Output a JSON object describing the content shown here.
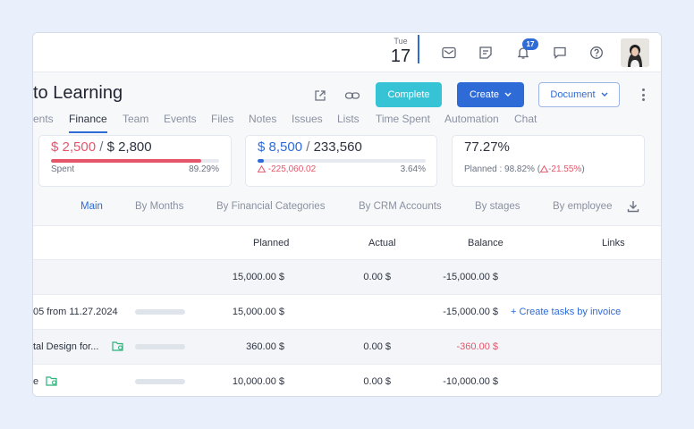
{
  "topbar": {
    "date_dow": "Tue",
    "date_day": "17",
    "notification_count": "17"
  },
  "header": {
    "title": "to Learning",
    "complete_label": "Complete",
    "create_label": "Create",
    "document_label": "Document"
  },
  "tabs": [
    {
      "label": "ents",
      "active": false
    },
    {
      "label": "Finance",
      "active": true
    },
    {
      "label": "Team",
      "active": false
    },
    {
      "label": "Events",
      "active": false
    },
    {
      "label": "Files",
      "active": false
    },
    {
      "label": "Notes",
      "active": false
    },
    {
      "label": "Issues",
      "active": false
    },
    {
      "label": "Lists",
      "active": false
    },
    {
      "label": "Time Spent",
      "active": false
    },
    {
      "label": "Automation",
      "active": false
    },
    {
      "label": "Chat",
      "active": false
    }
  ],
  "cards": {
    "spent": {
      "value": "$ 2,500",
      "separator": " / ",
      "total": "$ 2,800",
      "label": "Spent",
      "percent": "89.29%",
      "progress": 0.8929
    },
    "balance": {
      "value": "$ 8,500",
      "separator": " / ",
      "total": "233,560",
      "delta": "-225,060.02",
      "percent": "3.64%",
      "progress": 0.0364
    },
    "margin": {
      "value": "77.27%",
      "planned_label": "Planned : 98.82% (",
      "planned_delta": "-21.55%",
      "planned_close": ")"
    }
  },
  "subtabs": [
    {
      "label": "Main",
      "active": true
    },
    {
      "label": "By Months",
      "active": false
    },
    {
      "label": "By Financial Categories",
      "active": false
    },
    {
      "label": "By CRM Accounts",
      "active": false
    },
    {
      "label": "By stages",
      "active": false
    },
    {
      "label": "By employee",
      "active": false
    }
  ],
  "table": {
    "headers": {
      "planned": "Planned",
      "actual": "Actual",
      "balance": "Balance",
      "links": "Links"
    },
    "rows": [
      {
        "name": "",
        "planned": "15,000.00 $",
        "actual": "0.00 $",
        "balance": "-15,000.00 $",
        "link": ""
      },
      {
        "name": "05 from 11.27.2024",
        "planned": "15,000.00 $",
        "actual": "",
        "balance": "-15,000.00 $",
        "link": "+ Create tasks by invoice"
      },
      {
        "name": "tal Design for...",
        "planned": "360.00 $",
        "actual": "0.00 $",
        "balance": "-360.00 $",
        "link": ""
      },
      {
        "name": "e",
        "planned": "10,000.00 $",
        "actual": "0.00 $",
        "balance": "-10,000.00 $",
        "link": ""
      }
    ]
  },
  "colors": {
    "accent": "#2f6bd6",
    "complete": "#36c3d6",
    "negative": "#e5566b",
    "folder": "#2bb37a"
  }
}
